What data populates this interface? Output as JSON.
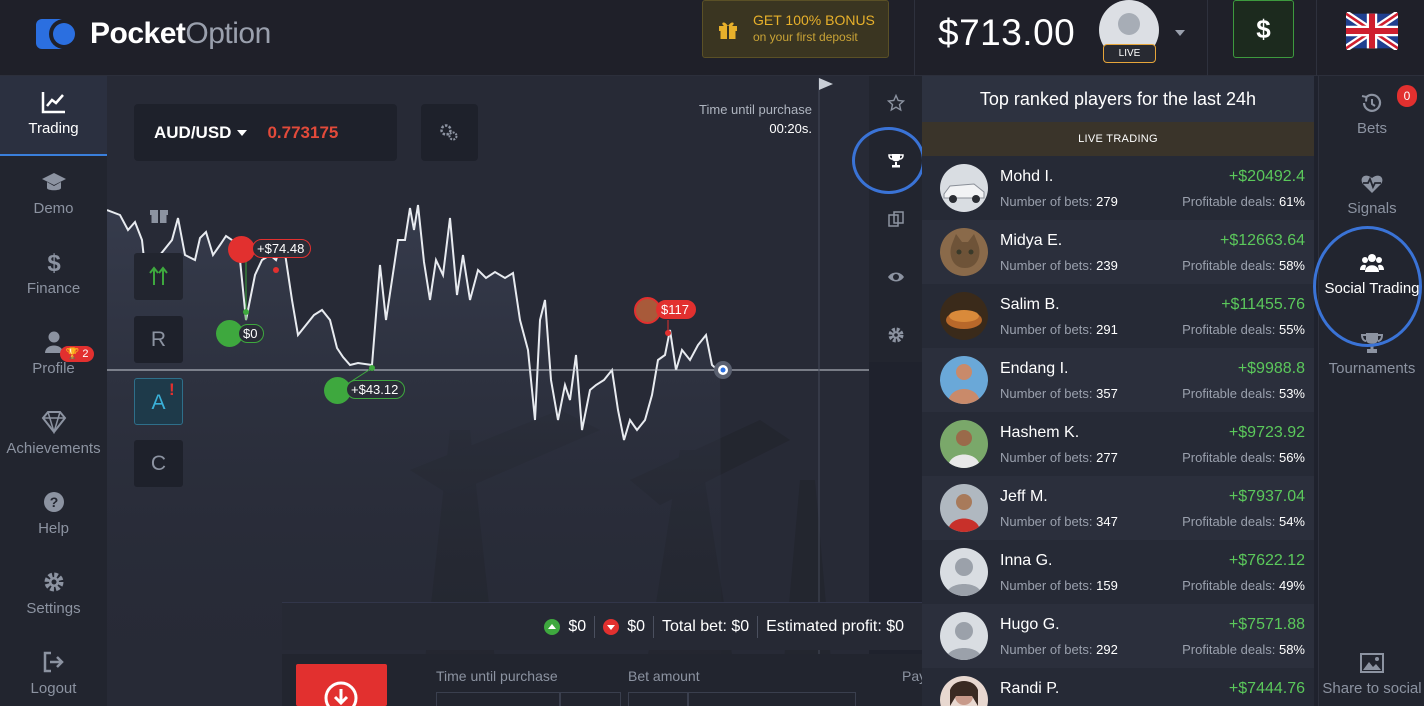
{
  "header": {
    "logo_bold": "Pocket",
    "logo_light": "Option",
    "bonus_title": "GET 100% BONUS",
    "bonus_sub": "on your first deposit",
    "balance": "$713.00",
    "account_type": "LIVE",
    "deposit_symbol": "$",
    "language_flag": "uk-flag-icon"
  },
  "left_nav": [
    {
      "label": "Trading",
      "icon": "chart-icon",
      "active": true
    },
    {
      "label": "Demo",
      "icon": "graduation-cap-icon"
    },
    {
      "label": "Finance",
      "icon": "dollar-icon"
    },
    {
      "label": "Profile",
      "icon": "user-icon"
    },
    {
      "label": "Achievements",
      "icon": "diamond-icon",
      "badge": "2"
    },
    {
      "label": "Help",
      "icon": "question-icon"
    },
    {
      "label": "Settings",
      "icon": "gear-icon"
    },
    {
      "label": "Logout",
      "icon": "logout-icon"
    }
  ],
  "chart": {
    "asset": "AUD/USD",
    "price": "0.773175",
    "time_label": "Time until purchase",
    "time_value": "00:20s.",
    "tools": [
      "R",
      "A",
      "C"
    ],
    "tool_alert": "!",
    "trades": [
      {
        "label": "+$74.48",
        "color": "#e2302f"
      },
      {
        "label": "$0",
        "color": "#3ea83e"
      },
      {
        "label": "+$43.12",
        "color": "#3ea83e"
      },
      {
        "label": "$117",
        "color": "#e2302f"
      }
    ]
  },
  "bet_summary": {
    "up_amount": "$0",
    "down_amount": "$0",
    "total_bet": "Total bet: $0",
    "estimated_profit": "Estimated profit: $0"
  },
  "trade_panel": {
    "time_label": "Time until purchase",
    "bet_label": "Bet amount",
    "payout_label": "Pay"
  },
  "leaderboard": {
    "title": "Top ranked players for the last 24h",
    "subtitle": "LIVE TRADING",
    "bets_label": "Number of bets:",
    "deals_label": "Profitable deals:",
    "players": [
      {
        "name": "Mohd I.",
        "profit": "+$20492.4",
        "bets": "279",
        "deals": "61%",
        "avatar_color": "#d9dde2"
      },
      {
        "name": "Midya E.",
        "profit": "+$12663.64",
        "bets": "239",
        "deals": "58%",
        "avatar_color": "#8a6a4a"
      },
      {
        "name": "Salim B.",
        "profit": "+$11455.76",
        "bets": "291",
        "deals": "55%",
        "avatar_color": "#9a5a2a"
      },
      {
        "name": "Endang I.",
        "profit": "+$9988.8",
        "bets": "357",
        "deals": "53%",
        "avatar_color": "#c98a6a"
      },
      {
        "name": "Hashem K.",
        "profit": "+$9723.92",
        "bets": "277",
        "deals": "56%",
        "avatar_color": "#6a8a5a"
      },
      {
        "name": "Jeff M.",
        "profit": "+$7937.04",
        "bets": "347",
        "deals": "54%",
        "avatar_color": "#a84a3a"
      },
      {
        "name": "Inna G.",
        "profit": "+$7622.12",
        "bets": "159",
        "deals": "49%",
        "avatar_color": "#d9dde2"
      },
      {
        "name": "Hugo G.",
        "profit": "+$7571.88",
        "bets": "292",
        "deals": "58%",
        "avatar_color": "#d9dde2"
      },
      {
        "name": "Randi P.",
        "profit": "+$7444.76",
        "bets": "",
        "deals": "",
        "avatar_color": "#b07a6a"
      }
    ]
  },
  "right_nav": [
    {
      "label": "Bets",
      "icon": "history-icon",
      "badge": "0"
    },
    {
      "label": "Signals",
      "icon": "heartbeat-icon"
    },
    {
      "label": "Social Trading",
      "icon": "users-icon",
      "active": true
    },
    {
      "label": "Tournaments",
      "icon": "trophy-icon"
    },
    {
      "label": "Share to social",
      "icon": "image-icon"
    }
  ]
}
